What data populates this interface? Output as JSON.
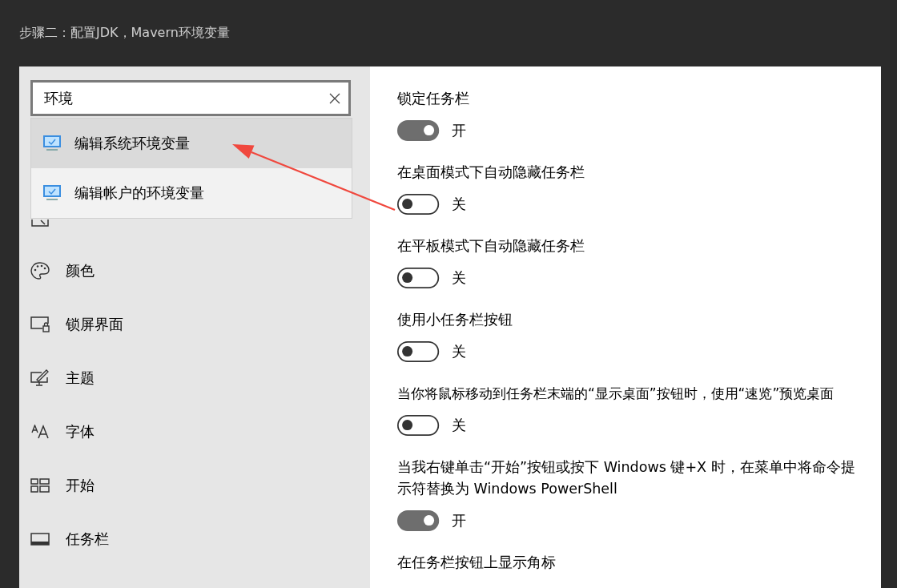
{
  "heading": "步骤二：配置JDK，Mavern环境变量",
  "search": {
    "value": "环境",
    "results": [
      {
        "label": "编辑系统环境变量",
        "selected": true
      },
      {
        "label": "编辑帐户的环境变量",
        "selected": false
      }
    ]
  },
  "sidebar": {
    "items": [
      {
        "label": "颜色"
      },
      {
        "label": "锁屏界面"
      },
      {
        "label": "主题"
      },
      {
        "label": "字体"
      },
      {
        "label": "开始"
      },
      {
        "label": "任务栏"
      }
    ]
  },
  "settings": [
    {
      "label": "锁定任务栏",
      "on": true,
      "state_text": "开"
    },
    {
      "label": "在桌面模式下自动隐藏任务栏",
      "on": false,
      "state_text": "关"
    },
    {
      "label": "在平板模式下自动隐藏任务栏",
      "on": false,
      "state_text": "关"
    },
    {
      "label": "使用小任务栏按钮",
      "on": false,
      "state_text": "关"
    },
    {
      "label": "当你将鼠标移动到任务栏末端的“显示桌面”按钮时，使用“速览”预览桌面",
      "on": false,
      "state_text": "关"
    },
    {
      "label": "当我右键单击“开始”按钮或按下 Windows 键+X 时，在菜单中将命令提示符替换为 Windows PowerShell",
      "on": true,
      "state_text": "开"
    },
    {
      "label": "在任务栏按钮上显示角标"
    }
  ]
}
